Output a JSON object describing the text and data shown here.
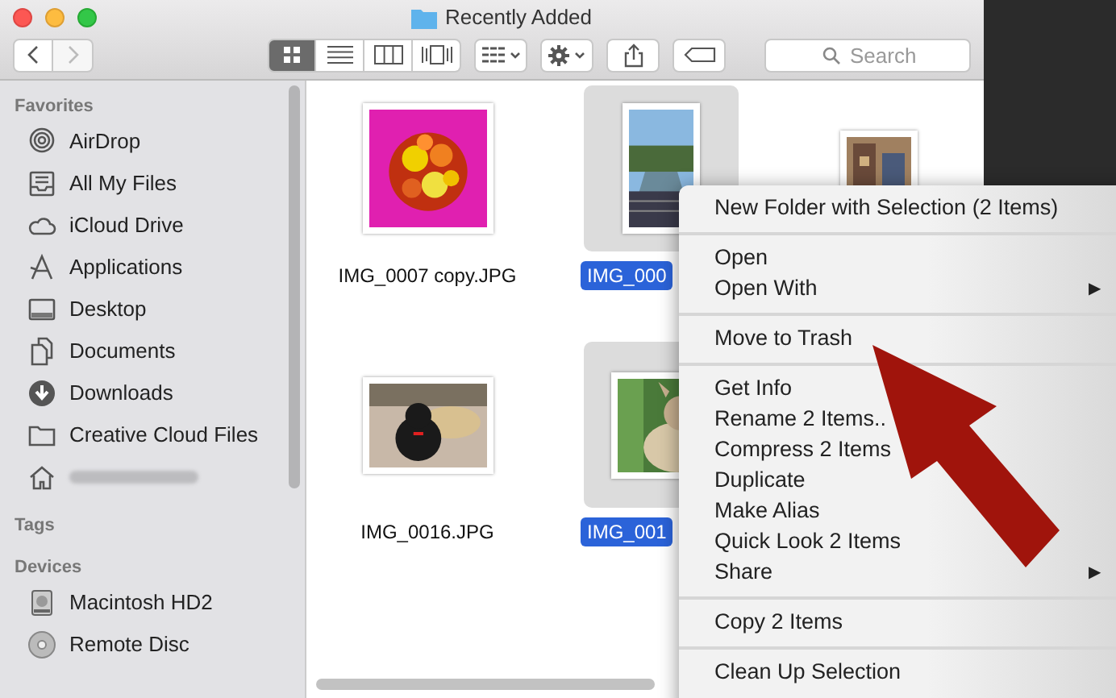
{
  "window": {
    "title": "Recently Added"
  },
  "toolbar": {
    "view_modes": [
      {
        "kind": "icons",
        "selected": true
      },
      {
        "kind": "list",
        "selected": false
      },
      {
        "kind": "columns",
        "selected": false
      },
      {
        "kind": "coverflow",
        "selected": false
      }
    ],
    "search": {
      "placeholder": "Search"
    }
  },
  "sidebar": {
    "sections": [
      {
        "title": "Favorites",
        "items": [
          {
            "kind": "airdrop",
            "label": "AirDrop"
          },
          {
            "kind": "files",
            "label": "All My Files"
          },
          {
            "kind": "cloud",
            "label": "iCloud Drive"
          },
          {
            "kind": "apps",
            "label": "Applications"
          },
          {
            "kind": "desktop",
            "label": "Desktop"
          },
          {
            "kind": "documents",
            "label": "Documents"
          },
          {
            "kind": "downloads",
            "label": "Downloads"
          },
          {
            "kind": "folder",
            "label": "Creative Cloud Files"
          },
          {
            "kind": "home",
            "blurred": true
          }
        ]
      },
      {
        "title": "Tags"
      },
      {
        "title": "Devices",
        "items": [
          {
            "kind": "disk",
            "label": "Macintosh HD2"
          },
          {
            "kind": "disc",
            "label": "Remote Disc"
          }
        ]
      }
    ]
  },
  "files": [
    {
      "name": "IMG_0007 copy.JPG",
      "selected": false
    },
    {
      "name": "IMG_000",
      "selected": true
    },
    {
      "selected": false
    },
    {
      "name": "IMG_0016.JPG",
      "selected": false
    },
    {
      "name": "IMG_001",
      "selected": true
    }
  ],
  "context_menu": {
    "groups": [
      [
        {
          "label": "New Folder with Selection (2 Items)"
        }
      ],
      [
        {
          "label": "Open"
        },
        {
          "label": "Open With",
          "submenu": true,
          "arrow": "▶"
        }
      ],
      [
        {
          "label": "Move to Trash"
        }
      ],
      [
        {
          "label": "Get Info"
        },
        {
          "label": "Rename 2 Items.."
        },
        {
          "label": "Compress 2 Items"
        },
        {
          "label": "Duplicate"
        },
        {
          "label": "Make Alias"
        },
        {
          "label": "Quick Look 2 Items"
        },
        {
          "label": "Share",
          "submenu": true,
          "arrow": "▶"
        }
      ],
      [
        {
          "label": "Copy 2 Items"
        }
      ],
      [
        {
          "label": "Clean Up Selection"
        }
      ]
    ]
  }
}
